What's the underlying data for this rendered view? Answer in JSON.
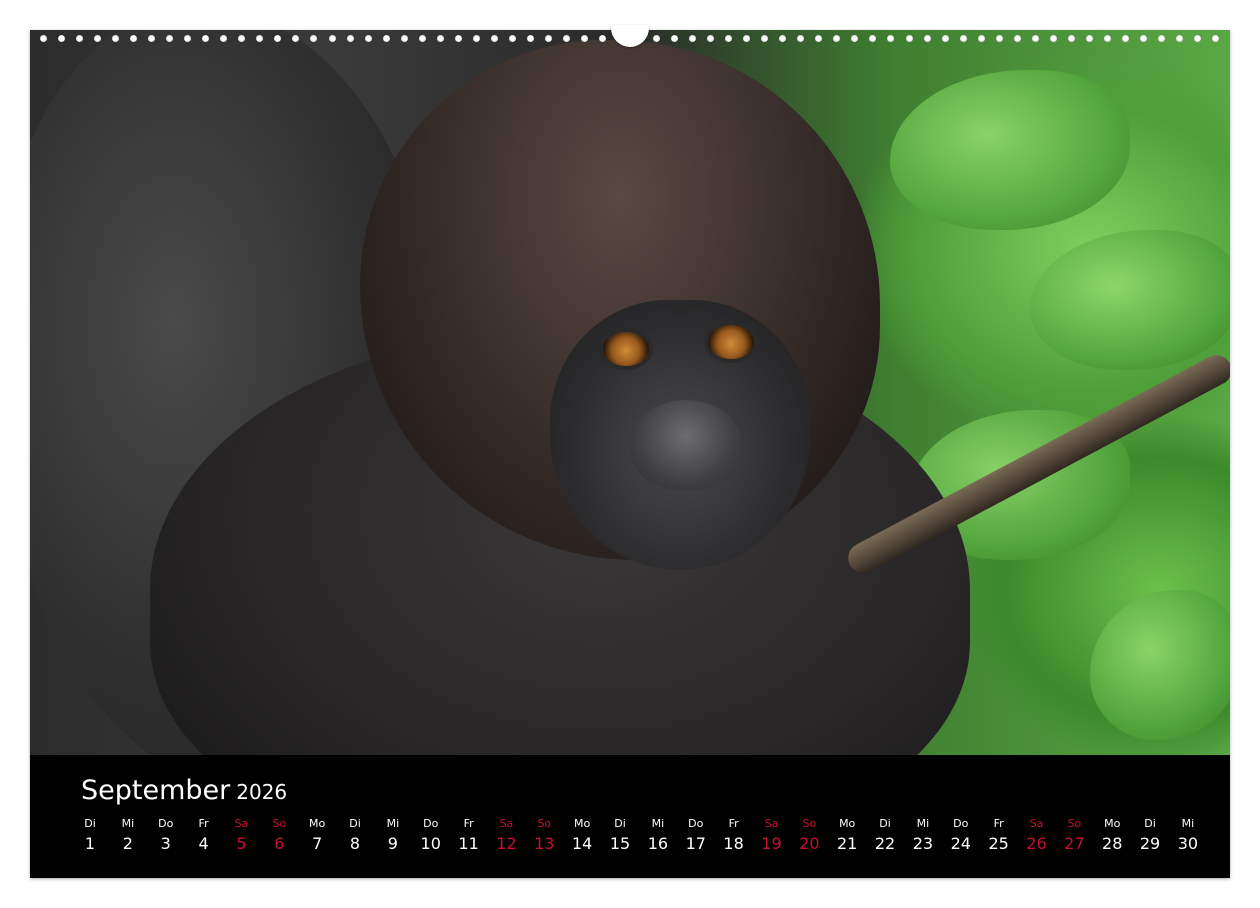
{
  "calendar": {
    "month": "September",
    "year": "2026",
    "weekend_color": "#c8102e",
    "days": [
      {
        "wd": "Di",
        "d": "1",
        "we": false
      },
      {
        "wd": "Mi",
        "d": "2",
        "we": false
      },
      {
        "wd": "Do",
        "d": "3",
        "we": false
      },
      {
        "wd": "Fr",
        "d": "4",
        "we": false
      },
      {
        "wd": "Sa",
        "d": "5",
        "we": true
      },
      {
        "wd": "So",
        "d": "6",
        "we": true
      },
      {
        "wd": "Mo",
        "d": "7",
        "we": false
      },
      {
        "wd": "Di",
        "d": "8",
        "we": false
      },
      {
        "wd": "Mi",
        "d": "9",
        "we": false
      },
      {
        "wd": "Do",
        "d": "10",
        "we": false
      },
      {
        "wd": "Fr",
        "d": "11",
        "we": false
      },
      {
        "wd": "Sa",
        "d": "12",
        "we": true
      },
      {
        "wd": "So",
        "d": "13",
        "we": true
      },
      {
        "wd": "Mo",
        "d": "14",
        "we": false
      },
      {
        "wd": "Di",
        "d": "15",
        "we": false
      },
      {
        "wd": "Mi",
        "d": "16",
        "we": false
      },
      {
        "wd": "Do",
        "d": "17",
        "we": false
      },
      {
        "wd": "Fr",
        "d": "18",
        "we": false
      },
      {
        "wd": "Sa",
        "d": "19",
        "we": true
      },
      {
        "wd": "So",
        "d": "20",
        "we": true
      },
      {
        "wd": "Mo",
        "d": "21",
        "we": false
      },
      {
        "wd": "Di",
        "d": "22",
        "we": false
      },
      {
        "wd": "Mi",
        "d": "23",
        "we": false
      },
      {
        "wd": "Do",
        "d": "24",
        "we": false
      },
      {
        "wd": "Fr",
        "d": "25",
        "we": false
      },
      {
        "wd": "Sa",
        "d": "26",
        "we": true
      },
      {
        "wd": "So",
        "d": "27",
        "we": true
      },
      {
        "wd": "Mo",
        "d": "28",
        "we": false
      },
      {
        "wd": "Di",
        "d": "29",
        "we": false
      },
      {
        "wd": "Mi",
        "d": "30",
        "we": false
      }
    ]
  }
}
